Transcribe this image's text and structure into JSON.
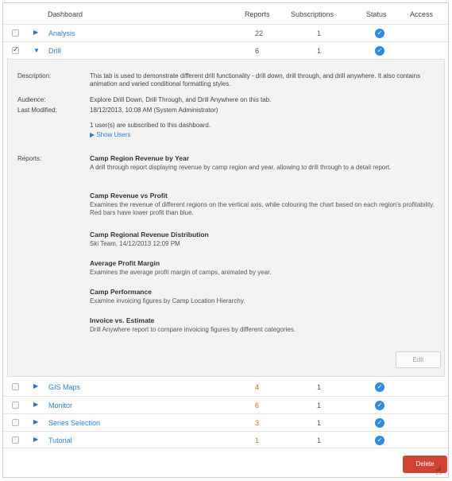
{
  "header": {
    "dashboard": "Dashboard",
    "reports": "Reports",
    "subscriptions": "Subscriptions",
    "status": "Status",
    "access": "Access"
  },
  "rows": [
    {
      "name": "Analysis",
      "reports": "22",
      "subscriptions": "1",
      "checked": false
    },
    {
      "name": "Drill",
      "reports": "6",
      "subscriptions": "1",
      "checked": true
    },
    {
      "name": "GIS Maps",
      "reports": "4",
      "subscriptions": "1",
      "checked": false
    },
    {
      "name": "Monitor",
      "reports": "6",
      "subscriptions": "1",
      "checked": false
    },
    {
      "name": "Series Selection",
      "reports": "3",
      "subscriptions": "1",
      "checked": false
    },
    {
      "name": "Tutorial",
      "reports": "1",
      "subscriptions": "1",
      "checked": false
    }
  ],
  "detail": {
    "description_label": "Description:",
    "description": "This tab is used to demonstrate different drill functionality - drill down, drill through, and drill anywhere. It also contains animation and varied conditional formatting styles.",
    "audience_label": "Audience:",
    "audience": "Explore Drill Down, Drill Through, and Drill Anywhere on this tab.",
    "last_modified_label": "Last Modified:",
    "last_modified": "18/12/2013, 10:08 AM (System Administrator)",
    "subscribed": "1 user(s) are subscribed to this dashboard.",
    "show_users": "▶ Show Users",
    "reports_label": "Reports:",
    "reports": [
      {
        "title": "Camp Region Revenue by Year",
        "desc": "A drill through report displaying revenue by camp region and year, allowing to drill through to a detail report."
      },
      {
        "title": "Camp Revenue vs Profit",
        "desc": "Examines the revenue of different regions on the vertical axis, while colouring the chart based on each region's profitability. Red bars have lower profit than blue."
      },
      {
        "title": "Camp Regional Revenue Distribution",
        "desc": "Ski Team, 14/12/2013 12:09 PM"
      },
      {
        "title": "Average Profit Margin",
        "desc": "Examines the average profit margin of camps, animated by year."
      },
      {
        "title": "Camp Performance",
        "desc": "Examine invoicing figures by Camp Location Hierarchy."
      },
      {
        "title": "Invoice vs. Estimate",
        "desc": "Drill Anywhere report to compare invoicing figures by different categories."
      }
    ],
    "edit_label": "Edit"
  },
  "delete_label": "Delete"
}
